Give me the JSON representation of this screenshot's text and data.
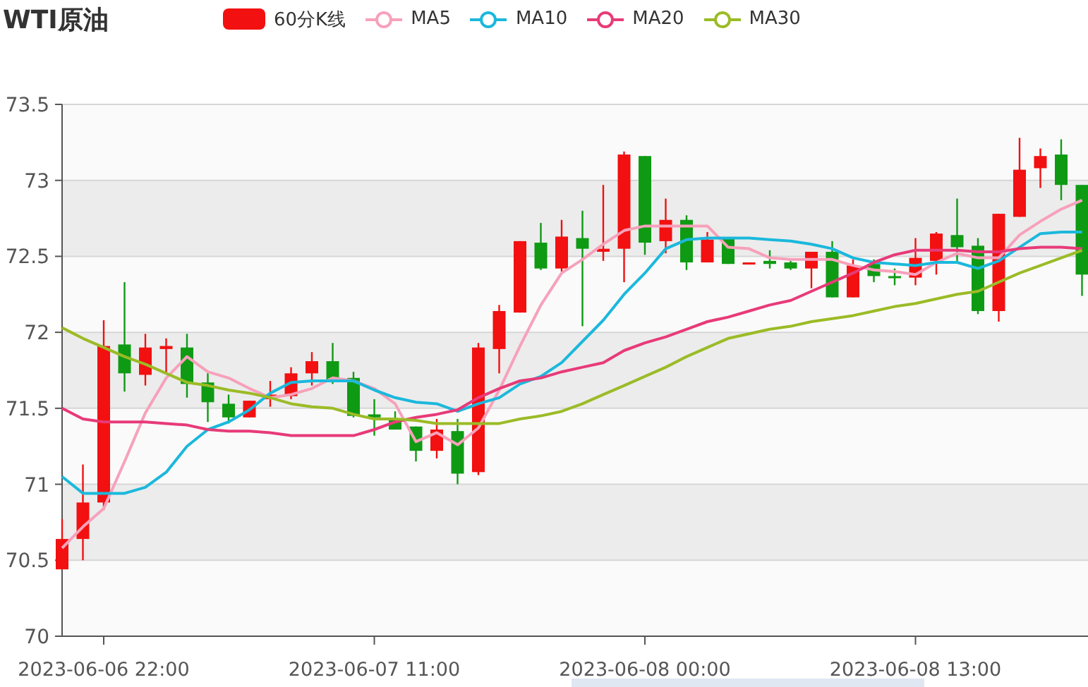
{
  "candle_legend": {
    "label": "60分K线",
    "color": "#f21010"
  },
  "chart": {
    "chart_data": {
      "type": "candlestick",
      "title": "WTI原油",
      "categories": [
        null,
        null,
        "2023-06-06 22:00",
        null,
        null,
        null,
        null,
        null,
        null,
        null,
        null,
        null,
        null,
        null,
        null,
        "2023-06-07 11:00",
        null,
        null,
        null,
        null,
        null,
        null,
        null,
        null,
        null,
        null,
        null,
        null,
        "2023-06-08 00:00",
        null,
        null,
        null,
        null,
        null,
        null,
        null,
        null,
        null,
        null,
        null,
        null,
        "2023-06-08 13:00",
        null,
        null,
        null,
        null,
        null,
        null,
        null,
        null
      ],
      "ohlc": [
        [
          70.44,
          70.77,
          70.44,
          70.64
        ],
        [
          70.64,
          71.13,
          70.5,
          70.88
        ],
        [
          70.88,
          72.08,
          70.83,
          71.91
        ],
        [
          71.92,
          72.33,
          71.61,
          71.73
        ],
        [
          71.72,
          71.99,
          71.65,
          71.9
        ],
        [
          71.89,
          71.96,
          71.73,
          71.91
        ],
        [
          71.9,
          71.99,
          71.57,
          71.66
        ],
        [
          71.67,
          71.73,
          71.41,
          71.54
        ],
        [
          71.53,
          71.59,
          71.4,
          71.44
        ],
        [
          71.44,
          71.55,
          71.44,
          71.55
        ],
        [
          71.56,
          71.68,
          71.51,
          71.59
        ],
        [
          71.58,
          71.77,
          71.56,
          71.73
        ],
        [
          71.73,
          71.87,
          71.65,
          71.81
        ],
        [
          71.81,
          71.93,
          71.66,
          71.68
        ],
        [
          71.7,
          71.74,
          71.44,
          71.45
        ],
        [
          71.46,
          71.56,
          71.32,
          71.44
        ],
        [
          71.43,
          71.48,
          71.36,
          71.36
        ],
        [
          71.38,
          71.38,
          71.15,
          71.22
        ],
        [
          71.22,
          71.43,
          71.17,
          71.36
        ],
        [
          71.35,
          71.43,
          71.0,
          71.07
        ],
        [
          71.08,
          71.93,
          71.06,
          71.9
        ],
        [
          71.89,
          72.18,
          71.73,
          72.14
        ],
        [
          72.13,
          72.6,
          72.13,
          72.6
        ],
        [
          72.59,
          72.72,
          72.41,
          72.42
        ],
        [
          72.42,
          72.74,
          72.4,
          72.63
        ],
        [
          72.62,
          72.8,
          72.04,
          72.55
        ],
        [
          72.53,
          72.97,
          72.47,
          72.55
        ],
        [
          72.55,
          73.19,
          72.33,
          73.17
        ],
        [
          73.16,
          73.16,
          72.51,
          72.59
        ],
        [
          72.6,
          72.88,
          72.52,
          72.74
        ],
        [
          72.74,
          72.77,
          72.41,
          72.46
        ],
        [
          72.46,
          72.66,
          72.46,
          72.61
        ],
        [
          72.62,
          72.62,
          72.45,
          72.45
        ],
        [
          72.45,
          72.46,
          72.45,
          72.46
        ],
        [
          72.47,
          72.54,
          72.42,
          72.45
        ],
        [
          72.46,
          72.47,
          72.41,
          72.42
        ],
        [
          72.42,
          72.53,
          72.29,
          72.53
        ],
        [
          72.53,
          72.6,
          72.23,
          72.23
        ],
        [
          72.23,
          72.48,
          72.23,
          72.44
        ],
        [
          72.45,
          72.48,
          72.33,
          72.37
        ],
        [
          72.37,
          72.42,
          72.31,
          72.36
        ],
        [
          72.36,
          72.62,
          72.31,
          72.49
        ],
        [
          72.47,
          72.66,
          72.38,
          72.65
        ],
        [
          72.64,
          72.88,
          72.47,
          72.56
        ],
        [
          72.57,
          72.62,
          72.12,
          72.14
        ],
        [
          72.14,
          72.78,
          72.07,
          72.78
        ],
        [
          72.76,
          73.28,
          72.76,
          73.07
        ],
        [
          73.08,
          73.21,
          72.95,
          73.16
        ],
        [
          73.17,
          73.27,
          72.87,
          72.97
        ],
        [
          72.97,
          72.97,
          72.24,
          72.38
        ]
      ],
      "series": [
        {
          "name": "MA5",
          "type": "line",
          "color": "#f7a1bb",
          "values": [
            70.58,
            70.72,
            70.84,
            71.15,
            71.47,
            71.7,
            71.84,
            71.74,
            71.7,
            71.63,
            71.57,
            71.59,
            71.63,
            71.7,
            71.68,
            71.63,
            71.53,
            71.28,
            71.34,
            71.26,
            71.37,
            71.62,
            71.91,
            72.18,
            72.39,
            72.48,
            72.58,
            72.67,
            72.7,
            72.7,
            72.7,
            72.7,
            72.56,
            72.55,
            72.49,
            72.48,
            72.48,
            72.48,
            72.44,
            72.41,
            72.4,
            72.38,
            72.46,
            72.52,
            72.49,
            72.49,
            72.64,
            72.73,
            72.81,
            72.87
          ]
        },
        {
          "name": "MA10",
          "type": "line",
          "color": "#1bb8dc",
          "values": [
            71.05,
            70.94,
            70.94,
            70.94,
            70.98,
            71.08,
            71.25,
            71.36,
            71.41,
            71.49,
            71.6,
            71.67,
            71.68,
            71.68,
            71.68,
            71.62,
            71.57,
            71.54,
            71.53,
            71.48,
            71.53,
            71.57,
            71.66,
            71.71,
            71.8,
            71.94,
            72.08,
            72.25,
            72.39,
            72.55,
            72.61,
            72.62,
            72.62,
            72.62,
            72.61,
            72.6,
            72.58,
            72.55,
            72.49,
            72.46,
            72.45,
            72.44,
            72.46,
            72.46,
            72.42,
            72.47,
            72.56,
            72.65,
            72.66,
            72.66
          ]
        },
        {
          "name": "MA20",
          "type": "line",
          "color": "#e83a78",
          "values": [
            71.5,
            71.43,
            71.41,
            71.41,
            71.41,
            71.4,
            71.39,
            71.36,
            71.35,
            71.35,
            71.34,
            71.32,
            71.32,
            71.32,
            71.32,
            71.36,
            71.41,
            71.44,
            71.46,
            71.49,
            71.57,
            71.63,
            71.68,
            71.7,
            71.74,
            71.77,
            71.8,
            71.88,
            71.93,
            71.97,
            72.02,
            72.07,
            72.1,
            72.14,
            72.18,
            72.21,
            72.27,
            72.33,
            72.39,
            72.46,
            72.51,
            72.54,
            72.54,
            72.54,
            72.53,
            72.53,
            72.55,
            72.56,
            72.56,
            72.55
          ]
        },
        {
          "name": "MA30",
          "type": "line",
          "color": "#9bbb26",
          "values": [
            72.03,
            71.96,
            71.9,
            71.84,
            71.79,
            71.73,
            71.67,
            71.65,
            71.62,
            71.6,
            71.57,
            71.53,
            71.51,
            71.5,
            71.46,
            71.43,
            71.43,
            71.42,
            71.4,
            71.4,
            71.4,
            71.4,
            71.43,
            71.45,
            71.48,
            71.53,
            71.59,
            71.65,
            71.71,
            71.77,
            71.84,
            71.9,
            71.96,
            71.99,
            72.02,
            72.04,
            72.07,
            72.09,
            72.11,
            72.14,
            72.17,
            72.19,
            72.22,
            72.25,
            72.27,
            72.33,
            72.39,
            72.44,
            72.49,
            72.54
          ]
        }
      ],
      "ylim": [
        70,
        73.5
      ],
      "yticks": [
        70,
        70.5,
        71,
        71.5,
        72,
        72.5,
        73,
        73.5
      ],
      "grid": true
    }
  }
}
